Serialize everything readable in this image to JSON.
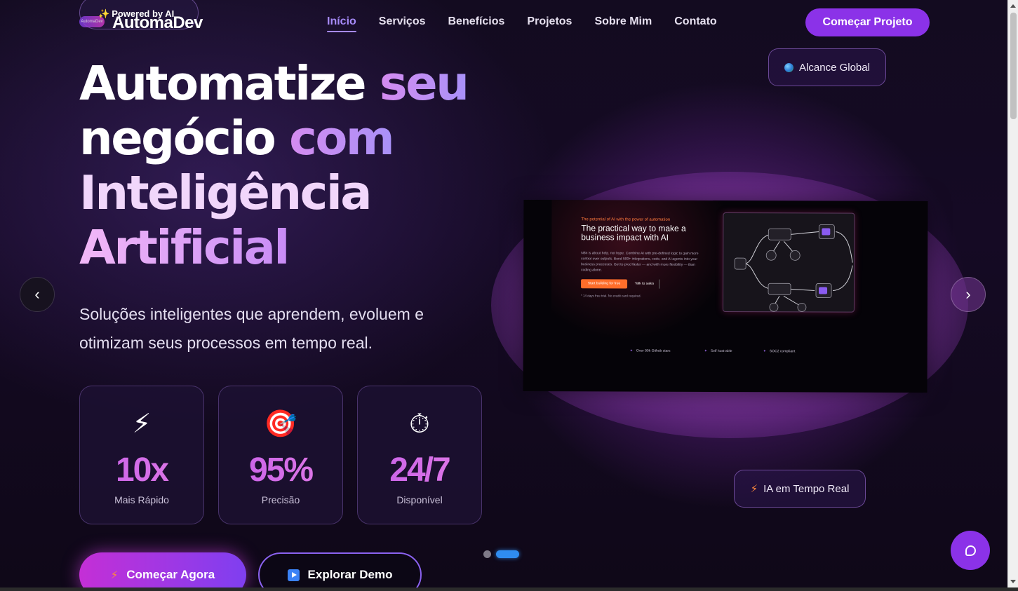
{
  "brand": {
    "badge": "Powered by AI",
    "badge_icon": "sparkles-icon",
    "name": "AutomaDev",
    "mini_logo_text": "AutomaDev"
  },
  "nav": {
    "items": [
      {
        "label": "Início",
        "active": true
      },
      {
        "label": "Serviços"
      },
      {
        "label": "Benefícios"
      },
      {
        "label": "Projetos"
      },
      {
        "label": "Sobre Mim"
      },
      {
        "label": "Contato"
      }
    ],
    "cta": "Começar Projeto"
  },
  "hero": {
    "title": {
      "line1a": "Automatize",
      "line1b": "seu",
      "line2a": "negócio",
      "line2b": "com",
      "line3": "Inteligência",
      "line4": "Artificial"
    },
    "subtitle": "Soluções inteligentes que aprendem, evoluem e otimizam seus processos em tempo real."
  },
  "stats": [
    {
      "icon": "lightning-icon",
      "glyph": "⚡",
      "value": "10x",
      "label": "Mais Rápido"
    },
    {
      "icon": "target-icon",
      "glyph": "🎯",
      "value": "95%",
      "label": "Precisão"
    },
    {
      "icon": "stopwatch-icon",
      "glyph": "⏱",
      "value": "24/7",
      "label": "Disponível"
    }
  ],
  "buttons": {
    "start": "Começar Agora",
    "demo": "Explorar Demo"
  },
  "chips": {
    "global": "Alcance Global",
    "realtime": "IA em Tempo Real"
  },
  "carousel": {
    "prev": "‹",
    "next": "›",
    "slide_count": 2,
    "active_index": 1
  },
  "mock": {
    "kicker": "The potential of AI with the power of automation",
    "title": "The practical way to make a business impact with AI",
    "body": "N8n is about help, not hype. Combine AI with pre-defined logic to gain more control over outputs. Bond 500+ integrations, code, and AI agents into your business processes. Get to prod faster — and with more flexibility — than coding alone.",
    "btn_primary": "Start building for free",
    "btn_secondary": "Talk to sales",
    "note": "* 14 days free trial. No credit card required.",
    "features": [
      "Over 90k Github stars",
      "Self host-able",
      "SOC2 compliant"
    ]
  },
  "colors": {
    "accent": "#8b32e8",
    "stat_gradient_start": "#c65fe9",
    "dot_active": "#2f8cf0"
  }
}
